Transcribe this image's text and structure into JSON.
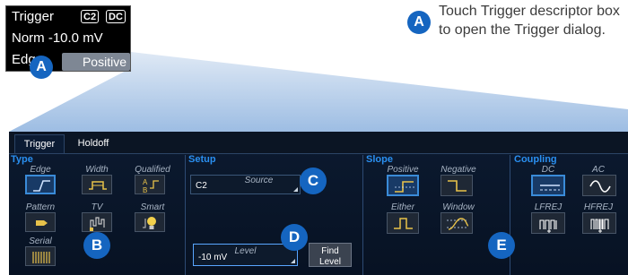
{
  "descriptor": {
    "title": "Trigger",
    "source_badge": "C2",
    "coupling_badge": "DC",
    "mode_level": "Norm  -10.0 mV",
    "type_abbrev": "Edge",
    "slope": "Positive"
  },
  "callout": {
    "marker": "A",
    "text": "Touch Trigger descriptor box to open the Trigger dialog."
  },
  "markers": {
    "a": "A",
    "b": "B",
    "c": "C",
    "d": "D",
    "e": "E"
  },
  "dialog": {
    "tabs": [
      "Trigger",
      "Holdoff"
    ],
    "type": {
      "title": "Type",
      "edge": "Edge",
      "width": "Width",
      "qualified": "Qualified",
      "pattern": "Pattern",
      "tv": "TV",
      "smart": "Smart",
      "serial": "Serial",
      "selected": "Edge"
    },
    "setup": {
      "title": "Setup",
      "source_label": "Source",
      "source_value": "C2",
      "level_label": "Level",
      "level_value": "-10 mV",
      "find_level": "Find Level"
    },
    "slope": {
      "title": "Slope",
      "positive": "Positive",
      "negative": "Negative",
      "either": "Either",
      "window": "Window",
      "selected": "Positive"
    },
    "coupling": {
      "title": "Coupling",
      "dc": "DC",
      "ac": "AC",
      "lfrej": "LFREJ",
      "hfrej": "HFREJ",
      "selected": "DC"
    }
  },
  "colors": {
    "marker": "#1565c0",
    "section_title": "#2a8ff0",
    "dialog_bg": "#0c1a30",
    "selected_button": "#183a66",
    "beam": "#a9c6e6"
  }
}
